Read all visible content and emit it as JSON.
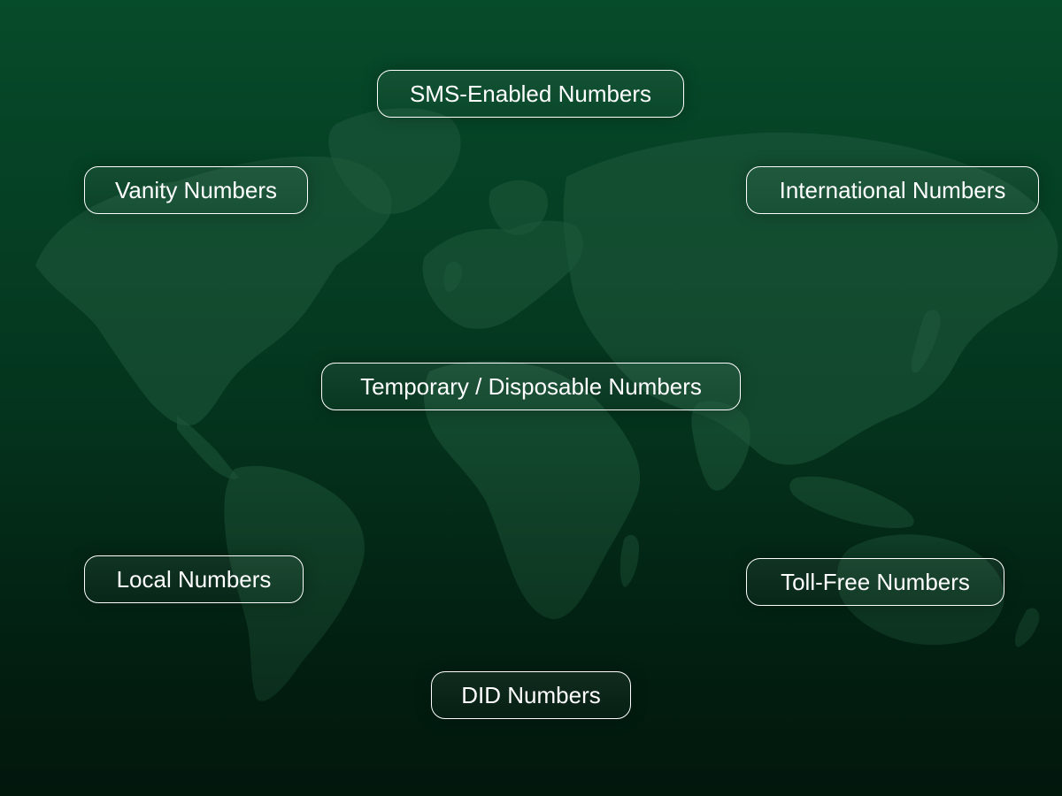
{
  "background": {
    "color_top": "#064b2a",
    "color_bottom": "#021c10",
    "map_color": "#1f5a3c",
    "decoration": "world-map"
  },
  "labels": {
    "sms": "SMS-Enabled Numbers",
    "vanity": "Vanity Numbers",
    "international": "International Numbers",
    "temporary": "Temporary / Disposable Numbers",
    "local": "Local Numbers",
    "toll_free": "Toll-Free Numbers",
    "did": "DID Numbers"
  },
  "pill_border_color": "#ffffff",
  "text_color": "#ffffff"
}
